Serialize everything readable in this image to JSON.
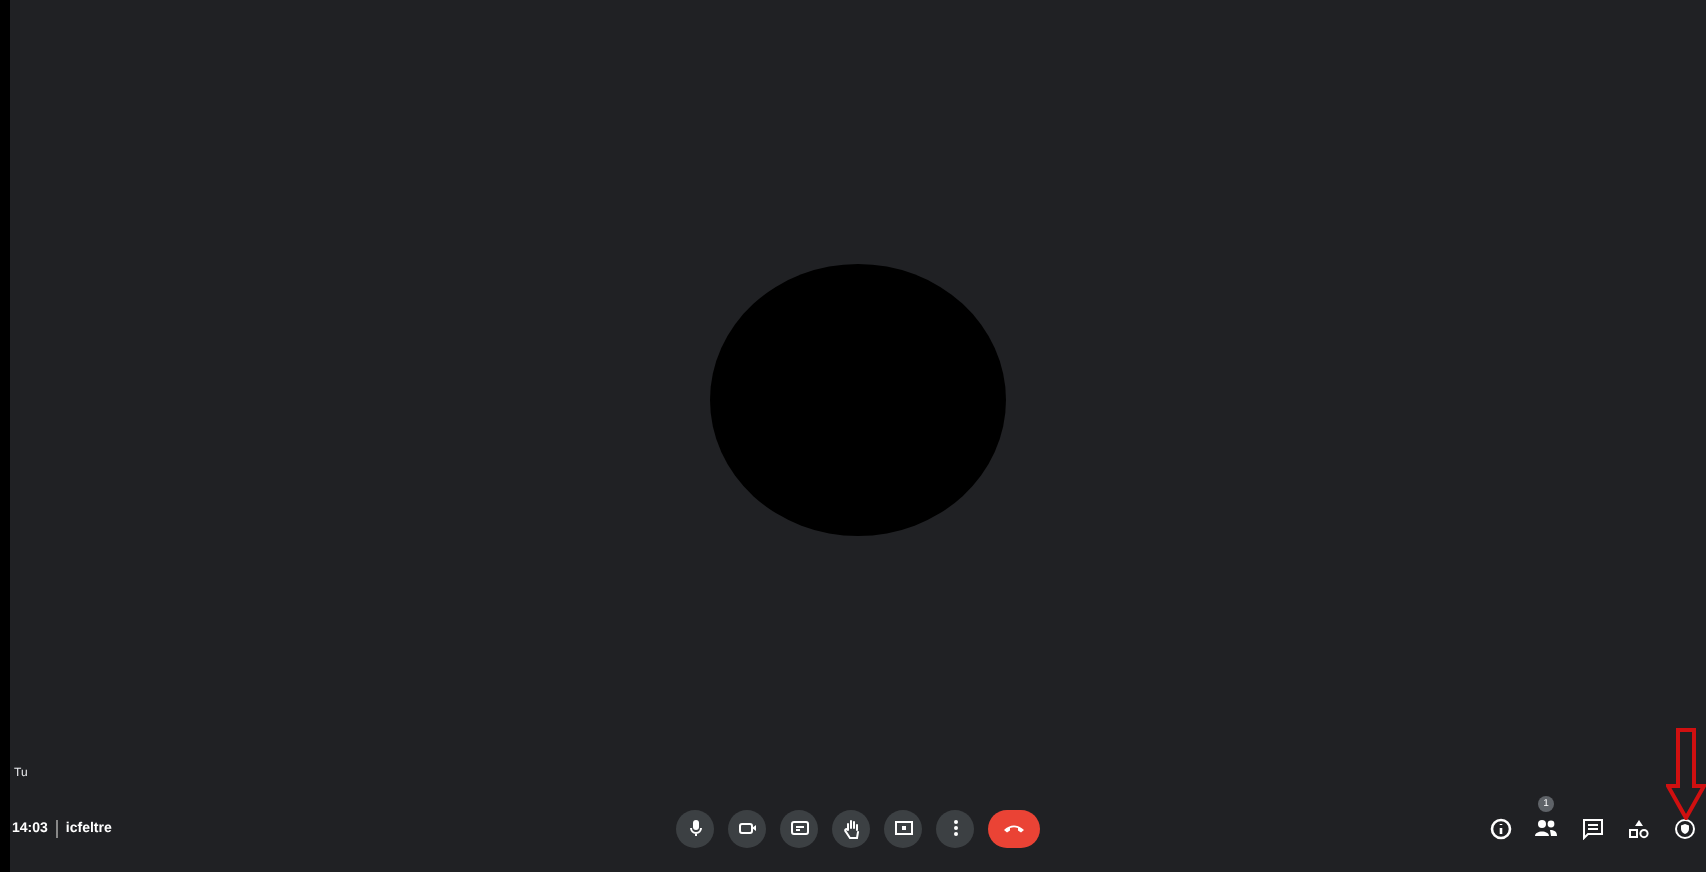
{
  "tile": {
    "name": "Tu"
  },
  "footer": {
    "time": "14:03",
    "meeting": "icfeltre",
    "participants_badge": "1"
  }
}
